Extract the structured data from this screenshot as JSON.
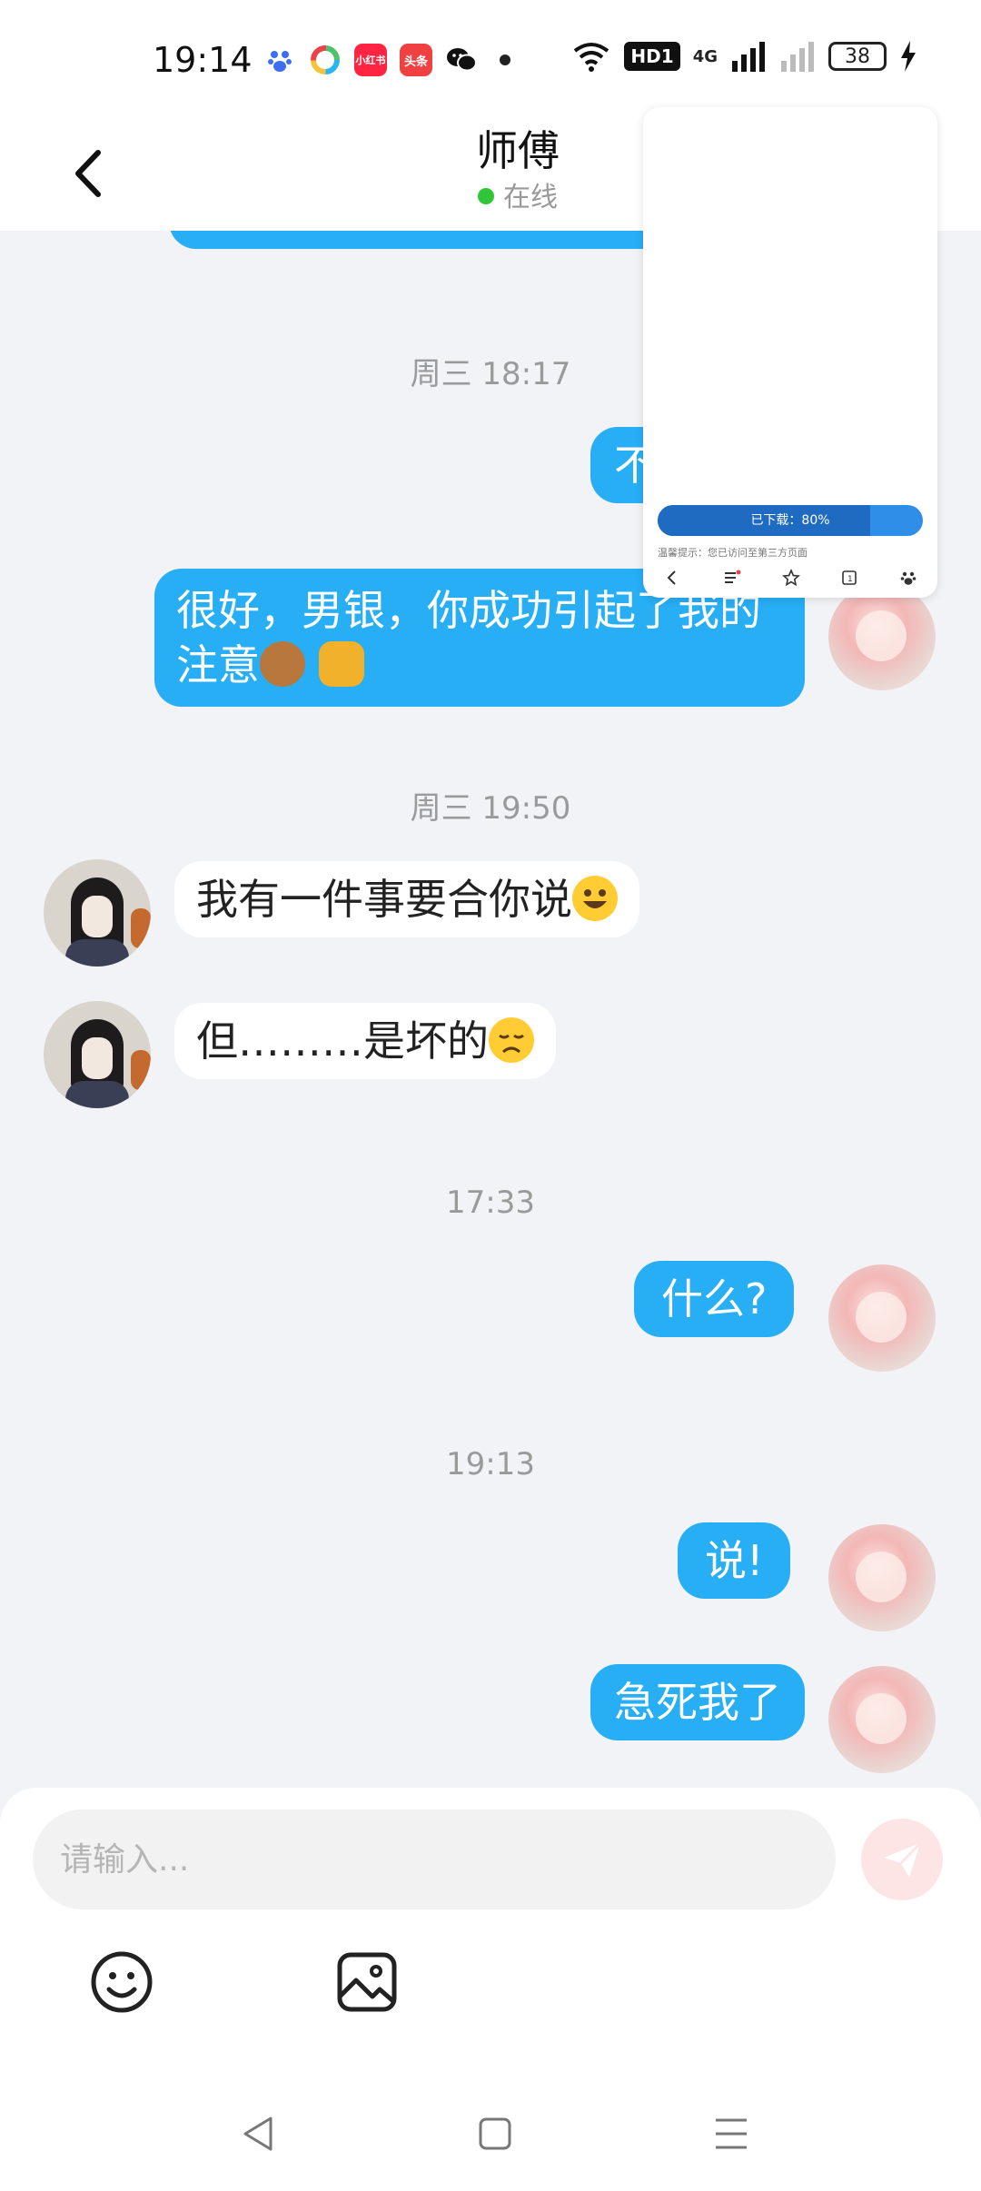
{
  "status_bar": {
    "time": "19:14",
    "apps": [
      {
        "icon": "baidu-paw-icon",
        "color": "#3b6ef0",
        "label": ""
      },
      {
        "icon": "colorful-circle-app-icon",
        "color": "#ffffff",
        "label": ""
      },
      {
        "icon": "xiaohongshu-icon",
        "color": "#ff2442",
        "label": "小红书"
      },
      {
        "icon": "toutiao-icon",
        "color": "#f04142",
        "label": "头条"
      },
      {
        "icon": "wechat-icon",
        "color": "#111111",
        "label": ""
      }
    ],
    "hd_label": "HD1",
    "network_label": "4G",
    "battery": "38"
  },
  "header": {
    "title": "师傅",
    "status": "在线",
    "status_color": "#32c53a"
  },
  "chat": {
    "messages": [
      {
        "type": "timestamp",
        "text": "周三 18:17"
      },
      {
        "type": "out",
        "text": "不"
      },
      {
        "type": "out",
        "text": "很好，男银，你成功引起了我的注意",
        "emojis": [
          "🐵",
          "👊"
        ]
      },
      {
        "type": "timestamp",
        "text": "周三 19:50"
      },
      {
        "type": "in",
        "text": "我有一件事要合你说",
        "emojis": [
          "😀"
        ]
      },
      {
        "type": "in",
        "text": "但………是坏的",
        "emojis": [
          "😞"
        ]
      },
      {
        "type": "timestamp",
        "text": "17:33"
      },
      {
        "type": "out",
        "text": "什么?"
      },
      {
        "type": "timestamp",
        "text": "19:13"
      },
      {
        "type": "out",
        "text": "说!"
      },
      {
        "type": "out",
        "text": "急死我了"
      }
    ]
  },
  "mini_window": {
    "progress_text": "已下载：80%",
    "progress": 0.8,
    "tip": "温馨提示：您已访问至第三方页面",
    "nav_icons": [
      "back-icon",
      "menu-icon",
      "star-icon",
      "tabs-icon",
      "baidu-paw-icon"
    ]
  },
  "composer": {
    "placeholder": "请输入..."
  },
  "colors": {
    "outgoing_bubble": "#27aef4",
    "incoming_bubble": "#ffffff",
    "background": "#f2f3f6",
    "send_button": "#fde5e6"
  }
}
